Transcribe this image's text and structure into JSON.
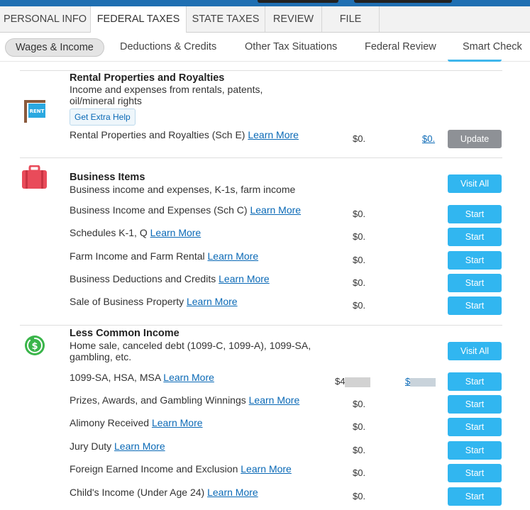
{
  "tabs": [
    {
      "label": "PERSONAL INFO"
    },
    {
      "label": "FEDERAL TAXES"
    },
    {
      "label": "STATE TAXES"
    },
    {
      "label": "REVIEW"
    },
    {
      "label": "FILE"
    }
  ],
  "subnav": [
    {
      "label": "Wages & Income"
    },
    {
      "label": "Deductions & Credits"
    },
    {
      "label": "Other Tax Situations"
    },
    {
      "label": "Federal Review"
    },
    {
      "label": "Smart Check"
    }
  ],
  "learn_more": "Learn More",
  "rental": {
    "title": "Rental Properties and Royalties",
    "desc": "Income and expenses from rentals, patents, oil/mineral rights",
    "help": "Get Extra Help",
    "sign_text": "RENT",
    "rows": [
      {
        "label": "Rental Properties and Royalties (Sch E)",
        "amount": "$0.",
        "refund": "$0.",
        "button": "Update"
      }
    ]
  },
  "business": {
    "title": "Business Items",
    "desc": "Business income and expenses, K-1s, farm income",
    "visit_all": "Visit All",
    "rows": [
      {
        "label": "Business Income and Expenses (Sch C)",
        "amount": "$0.",
        "button": "Start"
      },
      {
        "label": "Schedules K-1, Q",
        "amount": "$0.",
        "button": "Start"
      },
      {
        "label": "Farm Income and Farm Rental",
        "amount": "$0.",
        "button": "Start"
      },
      {
        "label": "Business Deductions and Credits",
        "amount": "$0.",
        "button": "Start"
      },
      {
        "label": "Sale of Business Property",
        "amount": "$0.",
        "button": "Start"
      }
    ]
  },
  "less_common": {
    "title": "Less Common Income",
    "desc": "Home sale, canceled debt (1099-C, 1099-A), 1099-SA, gambling, etc.",
    "visit_all": "Visit All",
    "rows": [
      {
        "label": "1099-SA, HSA, MSA",
        "amount": "$4",
        "refund": "$",
        "button": "Start"
      },
      {
        "label": "Prizes, Awards, and Gambling Winnings",
        "amount": "$0.",
        "button": "Start"
      },
      {
        "label": "Alimony Received",
        "amount": "$0.",
        "button": "Start"
      },
      {
        "label": "Jury Duty",
        "amount": "$0.",
        "button": "Start"
      },
      {
        "label": "Foreign Earned Income and Exclusion",
        "amount": "$0.",
        "button": "Start"
      },
      {
        "label": "Child's Income (Under Age 24)",
        "amount": "$0.",
        "button": "Start"
      }
    ]
  },
  "colors": {
    "accent": "#31b6f0",
    "link": "#0a69b6",
    "update_btn": "#8e9196",
    "business_icon": "#e94b5a",
    "income_icon": "#3ab54a"
  }
}
